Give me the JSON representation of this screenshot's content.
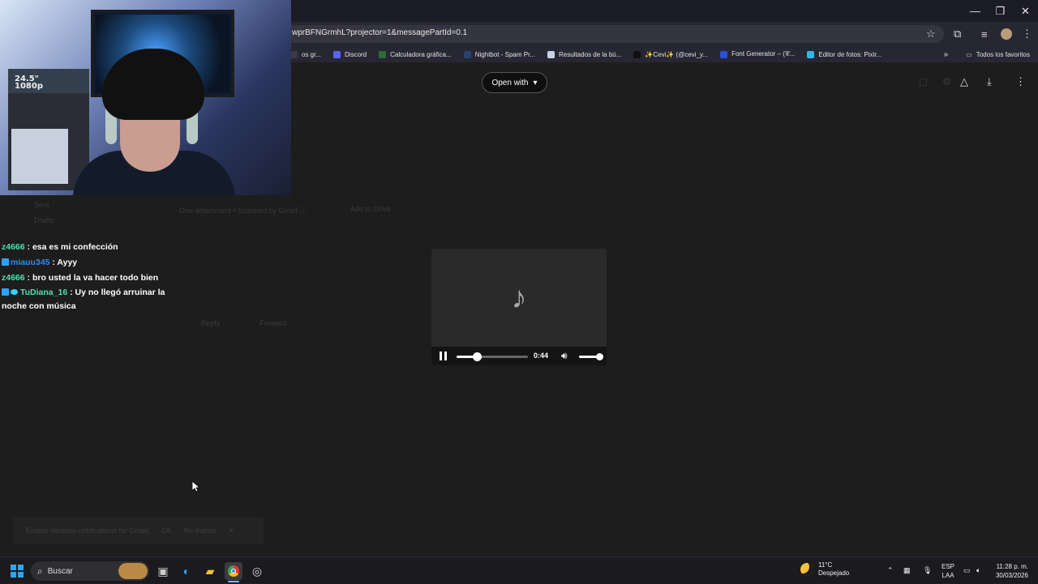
{
  "browser": {
    "url": "wprBFNGrmhL?projector=1&messagePartId=0.1",
    "window_controls": {
      "minimize": "—",
      "maximize": "❐",
      "close": "✕"
    },
    "bookmarks": [
      {
        "label": "os gr...",
        "icon": "bookmark-icon",
        "color": "#3a3a44"
      },
      {
        "label": "Discord",
        "icon": "discord-icon",
        "color": "#5865f2"
      },
      {
        "label": "Calculadora gráfica...",
        "icon": "desmos-icon",
        "color": "#2d6b3a"
      },
      {
        "label": "Nightbot - Spam Pr...",
        "icon": "nightbot-icon",
        "color": "#29436e"
      },
      {
        "label": "Resultados de la bú...",
        "icon": "page-icon",
        "color": "#c9d3e6"
      },
      {
        "label": "✨Cevi✨ (@cevi_y...",
        "icon": "tiktok-icon",
        "color": "#111111"
      },
      {
        "label": "Font Generator – (𝒞...",
        "icon": "font-icon",
        "color": "#2b4fd9"
      },
      {
        "label": "Editor de fotos: Pixlr...",
        "icon": "pixlr-icon",
        "color": "#2fb7e6"
      }
    ],
    "bookmarks_more": "»",
    "all_favorites": "Todos los favoritos"
  },
  "viewer": {
    "open_with": "Open with",
    "ghost_texts": {
      "attachments": "One attachment  •  Scanned by Gmail ⓘ",
      "add_drive": "Add to Drive",
      "reply": "Reply",
      "forward": "Forward",
      "sent": "Sent",
      "drafts": "Drafts"
    }
  },
  "player": {
    "time": "0:44",
    "progress_fraction": 0.28,
    "volume_fraction": 1.0
  },
  "chat": [
    {
      "user": "z4666",
      "message": "esa es mi confección",
      "color": "#4be1b0",
      "badge": ""
    },
    {
      "user": "miauu345",
      "message": "Ayyy",
      "color": "#2f88ff",
      "badge": "sub"
    },
    {
      "user": "z4666",
      "message": "bro usted la va hacer todo bien",
      "color": "#4be1b0",
      "badge": ""
    },
    {
      "user": "TuDiana_16",
      "message": "Uy no llegó arruinar la noche con música",
      "color": "#4be1b0",
      "badge": "vip"
    }
  ],
  "webcam": {
    "label_top": "24.5\"",
    "label_bottom": "1080p"
  },
  "toast": {
    "text": "Enable desktop notifications for Gmail.",
    "ok": "OK",
    "no_thanks": "No thanks",
    "close": "✕"
  },
  "taskbar": {
    "search_placeholder": "Buscar",
    "weather_temp": "11°C",
    "weather_desc": "Despejado",
    "lang_top": "ESP",
    "lang_bottom": "LAA",
    "time": "11:28 p. m.",
    "date": "30/03/2026"
  }
}
